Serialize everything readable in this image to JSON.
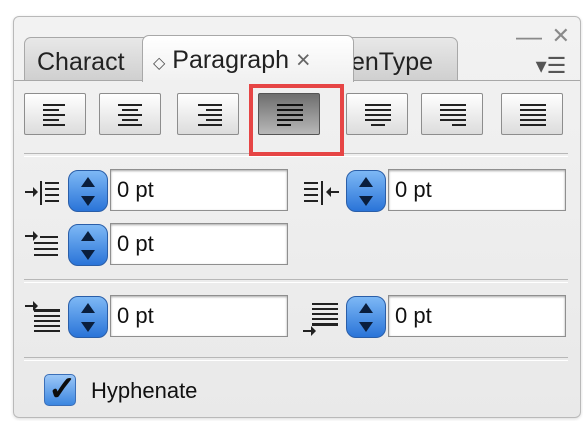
{
  "window": {
    "minimize_glyph": "—",
    "close_glyph": "✕",
    "menu_glyph": "▾☰"
  },
  "tabs": [
    {
      "label": "Charact",
      "active": false
    },
    {
      "label": "Paragraph",
      "active": true,
      "prefix": "◇",
      "close": "×"
    },
    {
      "label": "enType",
      "active": false
    }
  ],
  "alignment": {
    "buttons": [
      "align-left",
      "align-center",
      "align-right",
      "justify-last-left",
      "justify-last-center",
      "justify-last-right",
      "justify-all"
    ],
    "selected_index": 3,
    "highlight_color": "#e64545"
  },
  "indents": {
    "left_indent": {
      "value": "0 pt",
      "icon": "left-indent-icon"
    },
    "right_indent": {
      "value": "0 pt",
      "icon": "right-indent-icon"
    },
    "first_line_indent": {
      "value": "0 pt",
      "icon": "first-line-indent-icon"
    }
  },
  "spacing": {
    "space_before": {
      "value": "0 pt",
      "icon": "space-before-icon"
    },
    "space_after": {
      "value": "0 pt",
      "icon": "space-after-icon"
    }
  },
  "hyphenate": {
    "label": "Hyphenate",
    "checked": true,
    "mark": "✓"
  },
  "colors": {
    "accent": "#2a74d8"
  }
}
